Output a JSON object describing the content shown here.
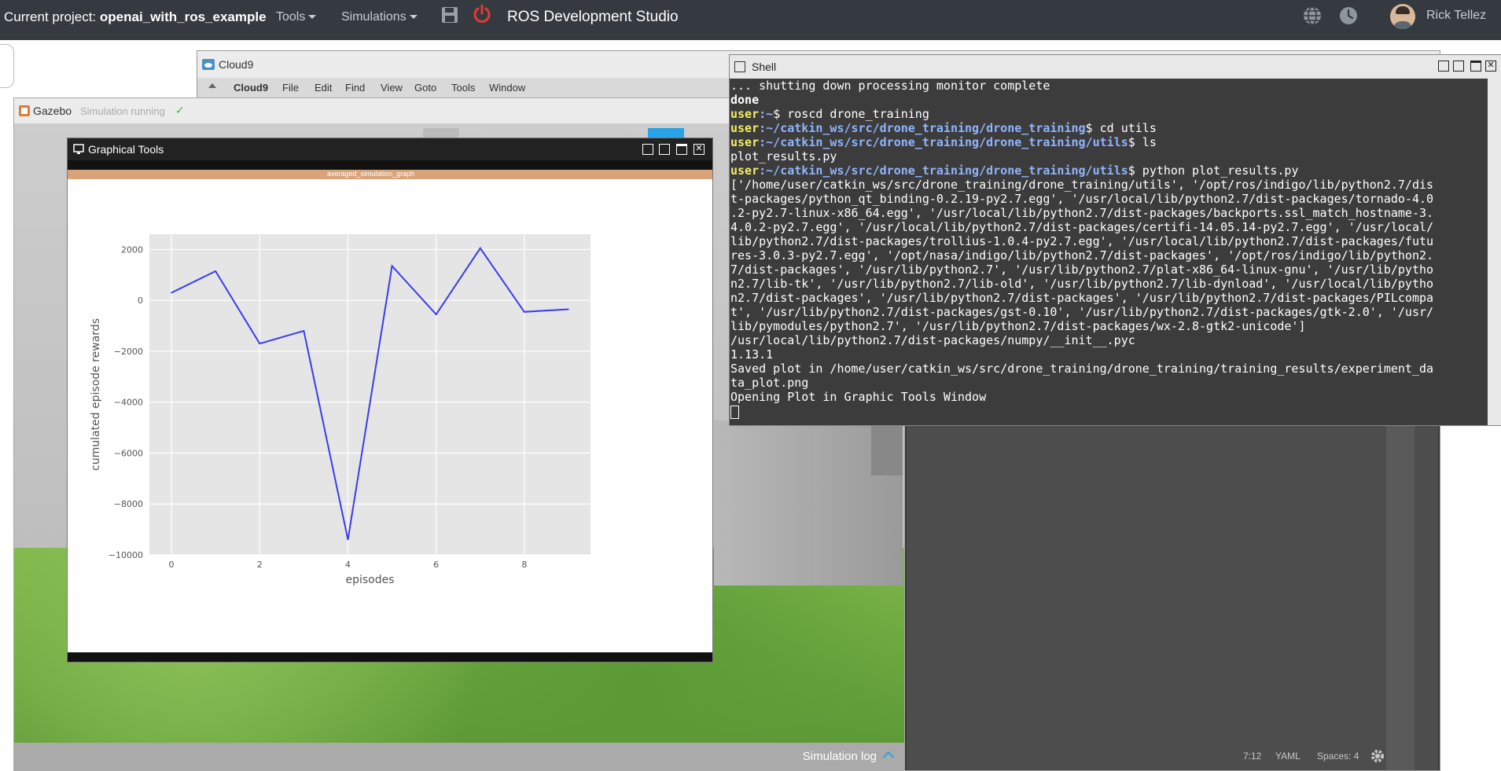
{
  "topbar": {
    "project_prefix": "Current project: ",
    "project_name": "openai_with_ros_example",
    "menu_tools": "Tools",
    "menu_simulations": "Simulations",
    "app_title": "ROS Development Studio",
    "user_name": "Rick Tellez"
  },
  "cloud9": {
    "title": "Cloud9",
    "menu": [
      "Cloud9",
      "File",
      "Edit",
      "Find",
      "View",
      "Goto",
      "Tools",
      "Window"
    ],
    "status": {
      "position": "7:12",
      "mode": "YAML",
      "spaces": "Spaces: 4"
    }
  },
  "gazebo": {
    "title": "Gazebo",
    "status": "Simulation running",
    "simulation_log": "Simulation log"
  },
  "graphical_tools": {
    "title": "Graphical Tools",
    "plot_window_title": "averaged_simulation_graph"
  },
  "shell": {
    "title": "Shell",
    "lines": [
      {
        "t": "... shutting down processing monitor complete"
      },
      {
        "t": "done",
        "bold": true
      },
      {
        "u": "user",
        "p": ":~",
        "c": "$ roscd drone_training"
      },
      {
        "u": "user",
        "p": ":~/catkin_ws/src/drone_training/drone_training",
        "c": "$ cd utils"
      },
      {
        "u": "user",
        "p": ":~/catkin_ws/src/drone_training/drone_training/utils",
        "c": "$ ls"
      },
      {
        "t": "plot_results.py"
      },
      {
        "u": "user",
        "p": ":~/catkin_ws/src/drone_training/drone_training/utils",
        "c": "$ python plot_results.py"
      },
      {
        "t": "['/home/user/catkin_ws/src/drone_training/drone_training/utils', '/opt/ros/indigo/lib/python2.7/dis"
      },
      {
        "t": "t-packages/python_qt_binding-0.2.19-py2.7.egg', '/usr/local/lib/python2.7/dist-packages/tornado-4.0"
      },
      {
        "t": ".2-py2.7-linux-x86_64.egg', '/usr/local/lib/python2.7/dist-packages/backports.ssl_match_hostname-3."
      },
      {
        "t": "4.0.2-py2.7.egg', '/usr/local/lib/python2.7/dist-packages/certifi-14.05.14-py2.7.egg', '/usr/local/"
      },
      {
        "t": "lib/python2.7/dist-packages/trollius-1.0.4-py2.7.egg', '/usr/local/lib/python2.7/dist-packages/futu"
      },
      {
        "t": "res-3.0.3-py2.7.egg', '/opt/nasa/indigo/lib/python2.7/dist-packages', '/opt/ros/indigo/lib/python2."
      },
      {
        "t": "7/dist-packages', '/usr/lib/python2.7', '/usr/lib/python2.7/plat-x86_64-linux-gnu', '/usr/lib/pytho"
      },
      {
        "t": "n2.7/lib-tk', '/usr/lib/python2.7/lib-old', '/usr/lib/python2.7/lib-dynload', '/usr/local/lib/pytho"
      },
      {
        "t": "n2.7/dist-packages', '/usr/lib/python2.7/dist-packages', '/usr/lib/python2.7/dist-packages/PILcompa"
      },
      {
        "t": "t', '/usr/lib/python2.7/dist-packages/gst-0.10', '/usr/lib/python2.7/dist-packages/gtk-2.0', '/usr/"
      },
      {
        "t": "lib/pymodules/python2.7', '/usr/lib/python2.7/dist-packages/wx-2.8-gtk2-unicode']"
      },
      {
        "t": "/usr/local/lib/python2.7/dist-packages/numpy/__init__.pyc"
      },
      {
        "t": "1.13.1"
      },
      {
        "t": "Saved plot in /home/user/catkin_ws/src/drone_training/drone_training/training_results/experiment_da"
      },
      {
        "t": "ta_plot.png"
      },
      {
        "t": "Opening Plot in Graphic Tools Window"
      }
    ]
  },
  "chart_data": {
    "type": "line",
    "xlabel": "episodes",
    "ylabel": "cumulated episode rewards",
    "x": [
      0,
      1,
      2,
      3,
      4,
      5,
      6,
      7,
      8,
      9
    ],
    "series": [
      {
        "values": [
          300,
          1150,
          -1700,
          -1200,
          -9400,
          1350,
          -550,
          2050,
          -450,
          -350
        ]
      }
    ],
    "xlim": [
      -0.5,
      9.5
    ],
    "ylim": [
      -10000,
      2600
    ],
    "xticks": [
      0,
      2,
      4,
      6,
      8
    ],
    "yticks": [
      2000,
      0,
      -2000,
      -4000,
      -6000,
      -8000,
      -10000
    ],
    "ytick_labels": [
      "2000",
      "0",
      "−2000",
      "−4000",
      "−6000",
      "−8000",
      "−10000"
    ],
    "grid": true,
    "line_color": "#3b3bf0",
    "background": "#e5e5e5"
  }
}
